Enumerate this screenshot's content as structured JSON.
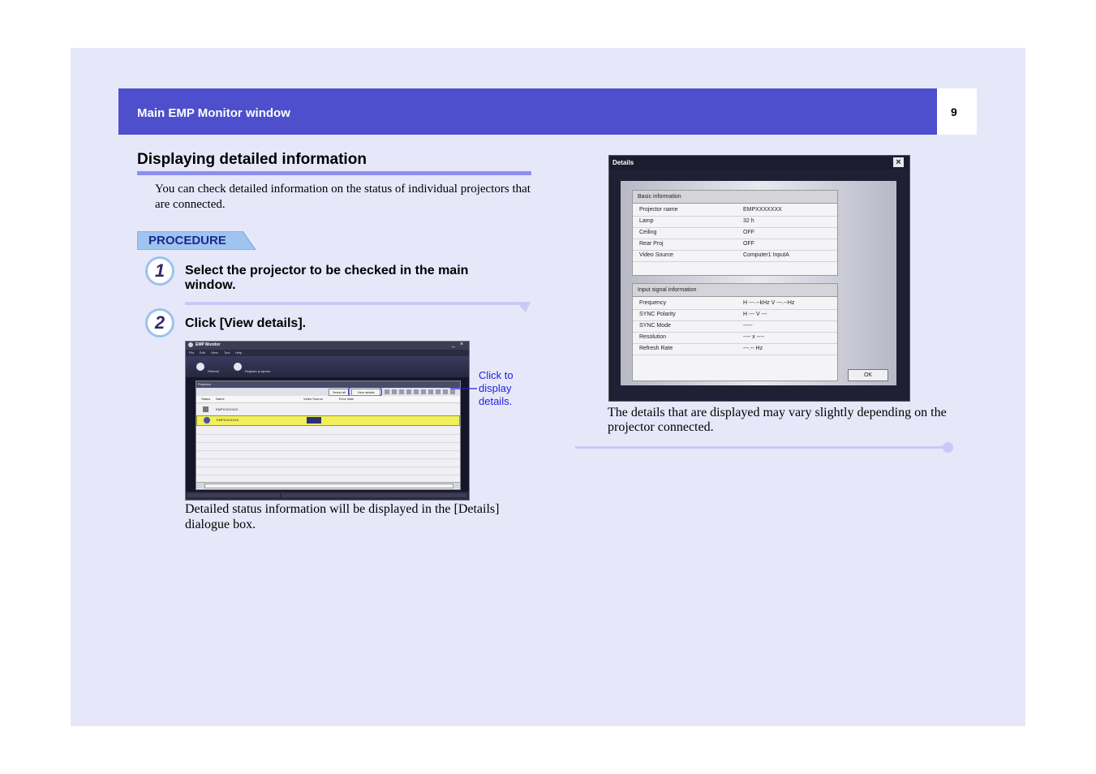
{
  "header": {
    "title": "Main EMP Monitor window",
    "page_number": "9"
  },
  "section": {
    "title": "Displaying detailed information",
    "intro": "You can check detailed information on the status of individual projectors that are connected."
  },
  "procedure_label": "PROCEDURE",
  "steps": [
    {
      "number": "1",
      "text": "Select the projector to be checked in the main window."
    },
    {
      "number": "2",
      "text": "Click [View details]."
    }
  ],
  "monitor_window": {
    "title": "EMP Monitor",
    "menu": [
      "File",
      "Edit",
      "View",
      "Tool",
      "Help"
    ],
    "toolbar": [
      "Refresh",
      "Register projector"
    ],
    "group_label": "Projector",
    "buttons": [
      "Select all",
      "View details"
    ],
    "columns": [
      "Status",
      "Name",
      "Video Source",
      "Error data"
    ],
    "rows": [
      {
        "name": "EMPXXXXXXX"
      },
      {
        "name": "EMPXXXXXXX"
      }
    ]
  },
  "callout": "Click to display details.",
  "caption1": "Detailed status information will be displayed in the [Details] dialogue box.",
  "details_dialog": {
    "title": "Details",
    "basic_header": "Basic information",
    "basic_rows": [
      {
        "label": "Projector name",
        "value": "EMPXXXXXXX"
      },
      {
        "label": "Lamp",
        "value": "32 h"
      },
      {
        "label": "Ceiling",
        "value": "OFF"
      },
      {
        "label": "Rear Proj",
        "value": "OFF"
      },
      {
        "label": "Video Source",
        "value": "Computer1 InputA"
      }
    ],
    "signal_header": "Input signal information",
    "signal_rows": [
      {
        "label": "Frequency",
        "value": "H ---.--kHz  V ---.--Hz"
      },
      {
        "label": "SYNC Polarity",
        "value": "H ---  V ---"
      },
      {
        "label": "SYNC Mode",
        "value": "-----"
      },
      {
        "label": "Resolution",
        "value": "---- x ----"
      },
      {
        "label": "Refresh Rate",
        "value": "---.-- Hz"
      }
    ],
    "ok_label": "OK"
  },
  "caption2": "The details that are displayed may vary slightly depending on the projector connected.",
  "colors": {
    "header": "#4d4fcc",
    "page_bg": "#e6e8fa",
    "accent_rule": "#8c8ef0",
    "callout": "#2222dd"
  }
}
